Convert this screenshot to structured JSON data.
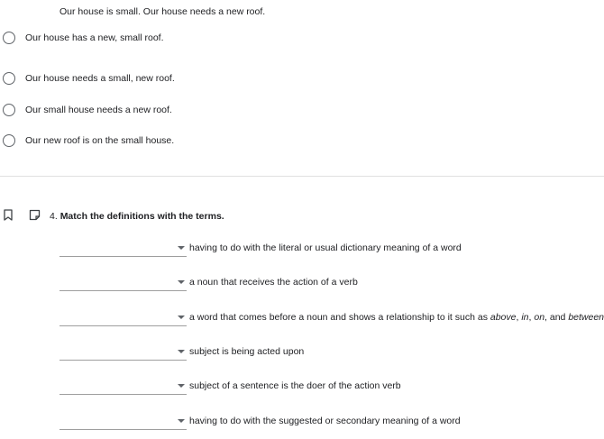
{
  "q3": {
    "prompt": "Our house is small. Our house needs a new roof.",
    "options": [
      "Our house has a new, small roof.",
      "Our house needs a small, new roof.",
      "Our small house needs a new roof.",
      "Our new roof is on the small house."
    ]
  },
  "q4": {
    "number": "4.",
    "title": "Match the definitions with the terms.",
    "definitions": [
      "having to do with the literal or usual dictionary meaning of a word",
      "a noun that receives the action of a verb",
      "a word that comes before a noun and shows a relationship to it such as ",
      "subject is being acted upon",
      "subject of a sentence is the doer of the action verb",
      "having to do with the suggested or secondary meaning of a word"
    ],
    "def3_examples": {
      "above": "above",
      "sep1": ", ",
      "in": "in",
      "sep2": ", ",
      "on": "on",
      "and": ", and ",
      "between": "between"
    },
    "dropdown_values": [
      "",
      "",
      "",
      "",
      "",
      ""
    ]
  },
  "icons": {
    "bookmark": "bookmark-icon",
    "note": "note-icon",
    "radio": "radio-icon",
    "dropdown": "chevron-down-icon"
  }
}
